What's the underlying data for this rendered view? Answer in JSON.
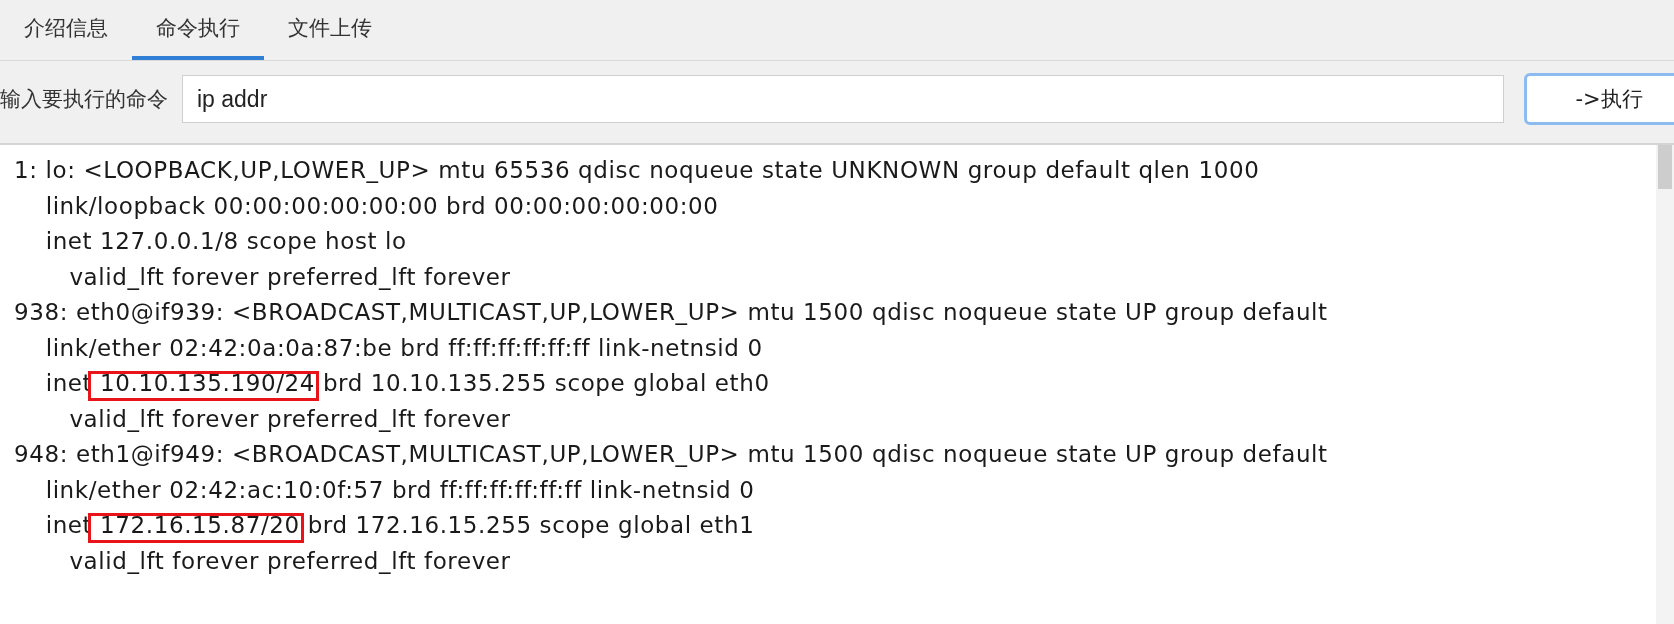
{
  "tabs": [
    {
      "label": "介绍信息",
      "selected": false
    },
    {
      "label": "命令执行",
      "selected": true
    },
    {
      "label": "文件上传",
      "selected": false
    }
  ],
  "command": {
    "label": "输入要执行的命令",
    "value": "ip addr",
    "button": "->执行"
  },
  "output": {
    "lines": [
      {
        "text": "1: lo: <LOOPBACK,UP,LOWER_UP> mtu 65536 qdisc noqueue state UNKNOWN group default qlen 1000"
      },
      {
        "text": "    link/loopback 00:00:00:00:00:00 brd 00:00:00:00:00:00"
      },
      {
        "text": "    inet 127.0.0.1/8 scope host lo"
      },
      {
        "text": "       valid_lft forever preferred_lft forever"
      },
      {
        "text": "938: eth0@if939: <BROADCAST,MULTICAST,UP,LOWER_UP> mtu 1500 qdisc noqueue state UP group default"
      },
      {
        "text": "    link/ether 02:42:0a:0a:87:be brd ff:ff:ff:ff:ff:ff link-netnsid 0"
      },
      {
        "text": "    inet 10.10.135.190/24 brd 10.10.135.255 scope global eth0",
        "highlighted": true
      },
      {
        "text": "       valid_lft forever preferred_lft forever"
      },
      {
        "text": "948: eth1@if949: <BROADCAST,MULTICAST,UP,LOWER_UP> mtu 1500 qdisc noqueue state UP group default"
      },
      {
        "text": "    link/ether 02:42:ac:10:0f:57 brd ff:ff:ff:ff:ff:ff link-netnsid 0"
      },
      {
        "text": "    inet 172.16.15.87/20 brd 172.16.15.255 scope global eth1",
        "highlighted": true
      },
      {
        "text": "       valid_lft forever preferred_lft forever"
      }
    ]
  }
}
